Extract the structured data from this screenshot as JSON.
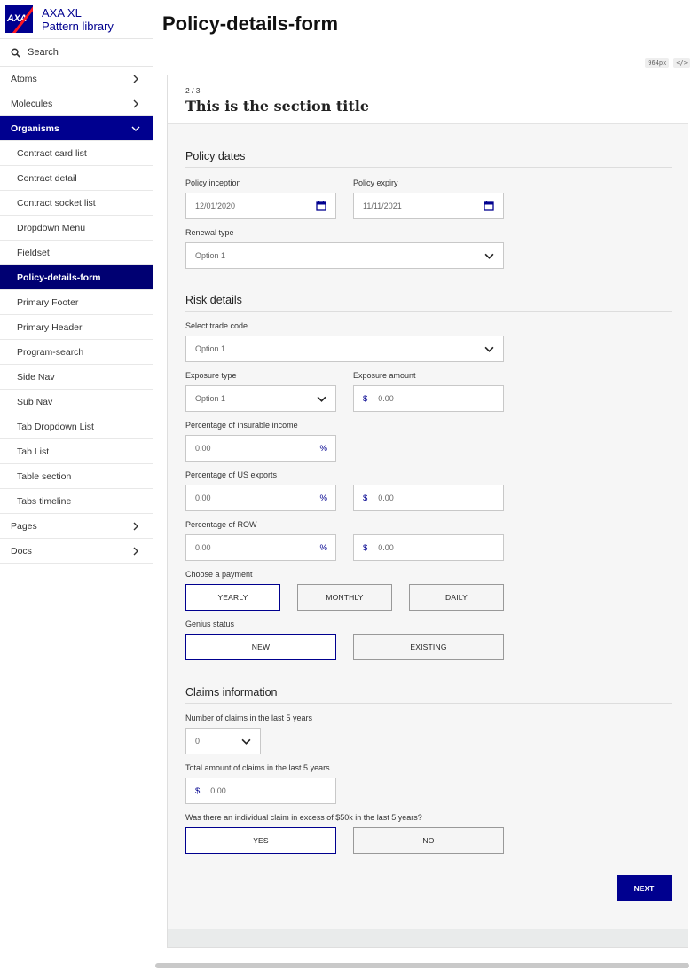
{
  "sidebar": {
    "brand_line1": "AXA XL",
    "brand_line2": "Pattern library",
    "logo_text": "AXA",
    "search_label": "Search",
    "groups": [
      {
        "label": "Atoms"
      },
      {
        "label": "Molecules"
      },
      {
        "label": "Organisms"
      }
    ],
    "organisms_items": [
      "Contract card list",
      "Contract detail",
      "Contract socket list",
      "Dropdown Menu",
      "Fieldset",
      "Policy-details-form",
      "Primary Footer",
      "Primary Header",
      "Program-search",
      "Side Nav",
      "Sub Nav",
      "Tab Dropdown List",
      "Tab List",
      "Table section",
      "Tabs timeline"
    ],
    "bottom_groups": [
      {
        "label": "Pages"
      },
      {
        "label": "Docs"
      }
    ],
    "accent": "#00008f"
  },
  "page": {
    "title": "Policy-details-form",
    "viewport_badge": "964px",
    "code_badge": "</>"
  },
  "form": {
    "step": "2 / 3",
    "section_title": "This is the section title",
    "policy_dates": {
      "title": "Policy dates",
      "inception_label": "Policy inception",
      "inception_value": "12/01/2020",
      "expiry_label": "Policy expiry",
      "expiry_value": "11/11/2021",
      "renewal_label": "Renewal type",
      "renewal_value": "Option 1"
    },
    "risk_details": {
      "title": "Risk details",
      "trade_code_label": "Select trade code",
      "trade_code_value": "Option 1",
      "exposure_type_label": "Exposure type",
      "exposure_type_value": "Option 1",
      "exposure_amount_label": "Exposure amount",
      "exposure_amount_value": "0.00",
      "insurable_income_label": "Percentage of insurable income",
      "insurable_income_value": "0.00",
      "us_exports_label": "Percentage of US exports",
      "us_exports_pct_value": "0.00",
      "us_exports_amount_value": "0.00",
      "row_label": "Percentage of ROW",
      "row_pct_value": "0.00",
      "row_amount_value": "0.00",
      "currency_symbol": "$",
      "percent_symbol": "%",
      "payment_label": "Choose a payment",
      "payment_options": [
        "YEARLY",
        "MONTHLY",
        "DAILY"
      ],
      "genius_label": "Genius status",
      "genius_options": [
        "NEW",
        "EXISTING"
      ]
    },
    "claims": {
      "title": "Claims information",
      "num_claims_label": "Number of claims in the last 5 years",
      "num_claims_value": "0",
      "total_amount_label": "Total amount of claims in the last 5 years",
      "total_amount_value": "0.00",
      "excess_label": "Was there an individual claim in excess of $50k in the last 5 years?",
      "excess_options": [
        "YES",
        "NO"
      ]
    },
    "next_label": "NEXT"
  }
}
